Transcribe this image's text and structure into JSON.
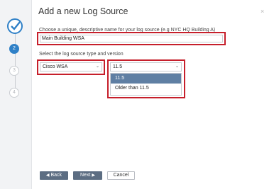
{
  "dialog": {
    "title": "Add a new Log Source",
    "close_label": "×"
  },
  "stepper": {
    "steps": [
      {
        "label": "",
        "state": "done"
      },
      {
        "label": "2",
        "state": "active"
      },
      {
        "label": "3",
        "state": "inactive"
      },
      {
        "label": "4",
        "state": "inactive"
      }
    ]
  },
  "form": {
    "name_prompt": "Choose a unique, descriptive name for your log source (e.g NYC HQ Building A)",
    "name_value": "Main Building WSA",
    "type_prompt": "Select the log source type and version",
    "type_value": "Cisco WSA",
    "version_value": "11.5",
    "version_options": [
      "11.5",
      "Older than 11.5"
    ]
  },
  "buttons": {
    "back": "Back",
    "next": "Next",
    "cancel": "Cancel"
  },
  "colors": {
    "accent": "#2f80c7",
    "highlight": "#c61f2b",
    "button": "#5c6d82",
    "selected_option": "#5f7fa3"
  }
}
